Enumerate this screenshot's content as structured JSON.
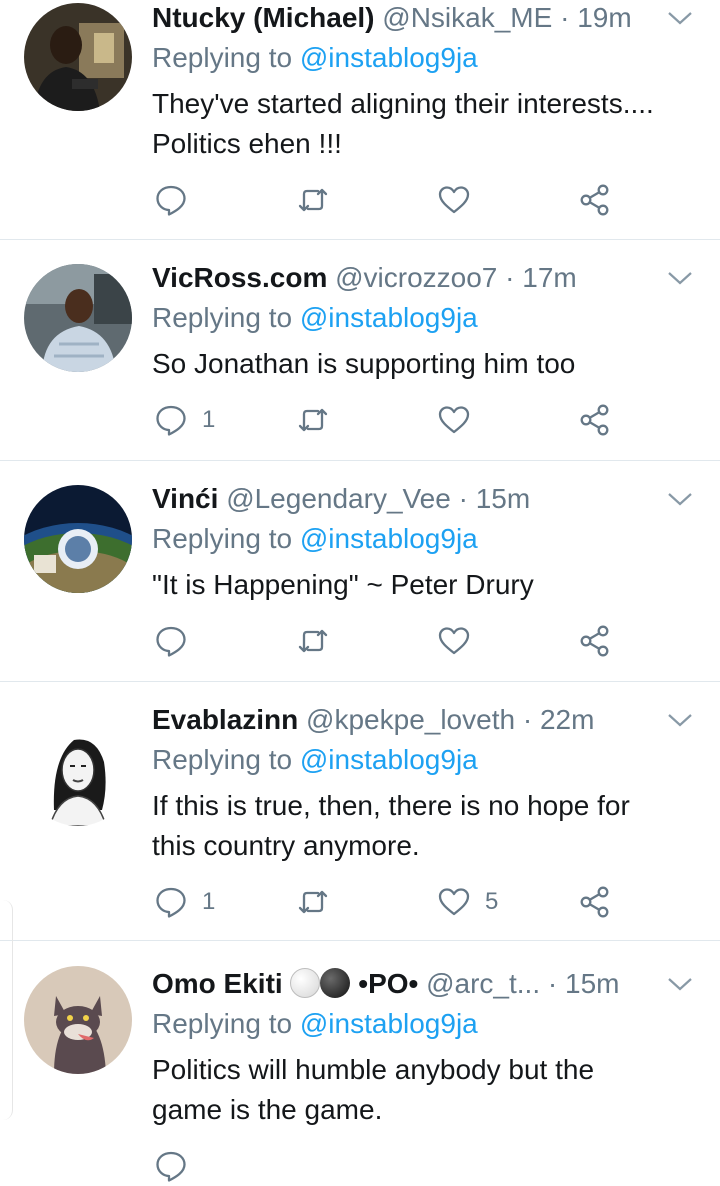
{
  "icons": {
    "reply": "reply-bubble-icon",
    "retweet": "retweet-icon",
    "like": "heart-icon",
    "share": "share-icon",
    "menu": "chevron-down-icon"
  },
  "colors": {
    "link": "#1da1f2",
    "muted": "#657786",
    "text": "#14171a",
    "divider": "#e1e8ed"
  },
  "tweets": [
    {
      "name": "Ntucky (Michael)",
      "handle": "@Nsikak_ME",
      "sep": "·",
      "time": "19m",
      "replying_prefix": "Replying to",
      "replying_to": "@instablog9ja",
      "text_lines": [
        "They've started aligning their interests....",
        "Politics ehen !!!"
      ],
      "reply_count": "",
      "retweet_count": "",
      "like_count": ""
    },
    {
      "name": "VicRoss.com",
      "handle": "@vicrozzoo7",
      "sep": "·",
      "time": "17m",
      "replying_prefix": "Replying to",
      "replying_to": "@instablog9ja",
      "text_lines": [
        "So Jonathan is supporting him too"
      ],
      "reply_count": "1",
      "retweet_count": "",
      "like_count": ""
    },
    {
      "name": "Vinći",
      "handle": "@Legendary_Vee",
      "sep": "·",
      "time": "15m",
      "replying_prefix": "Replying to",
      "replying_to": "@instablog9ja",
      "text_lines": [
        "\"It is Happening\" ~ Peter Drury"
      ],
      "reply_count": "",
      "retweet_count": "",
      "like_count": ""
    },
    {
      "name": "Evablazinn",
      "handle": "@kpekpe_loveth",
      "sep": "·",
      "time": "22m",
      "replying_prefix": "Replying to",
      "replying_to": "@instablog9ja",
      "text_lines": [
        "If this is true, then, there is no hope for",
        "this country anymore."
      ],
      "reply_count": "1",
      "retweet_count": "",
      "like_count": "5"
    },
    {
      "name": "Omo Ekiti",
      "name_suffix": "•PO•",
      "handle": "@arc_t...",
      "sep": "·",
      "time": "15m",
      "replying_prefix": "Replying to",
      "replying_to": "@instablog9ja",
      "text_lines": [
        "Politics will humble anybody but the",
        "game is the game."
      ],
      "reply_count": "",
      "retweet_count": "",
      "like_count": ""
    }
  ]
}
